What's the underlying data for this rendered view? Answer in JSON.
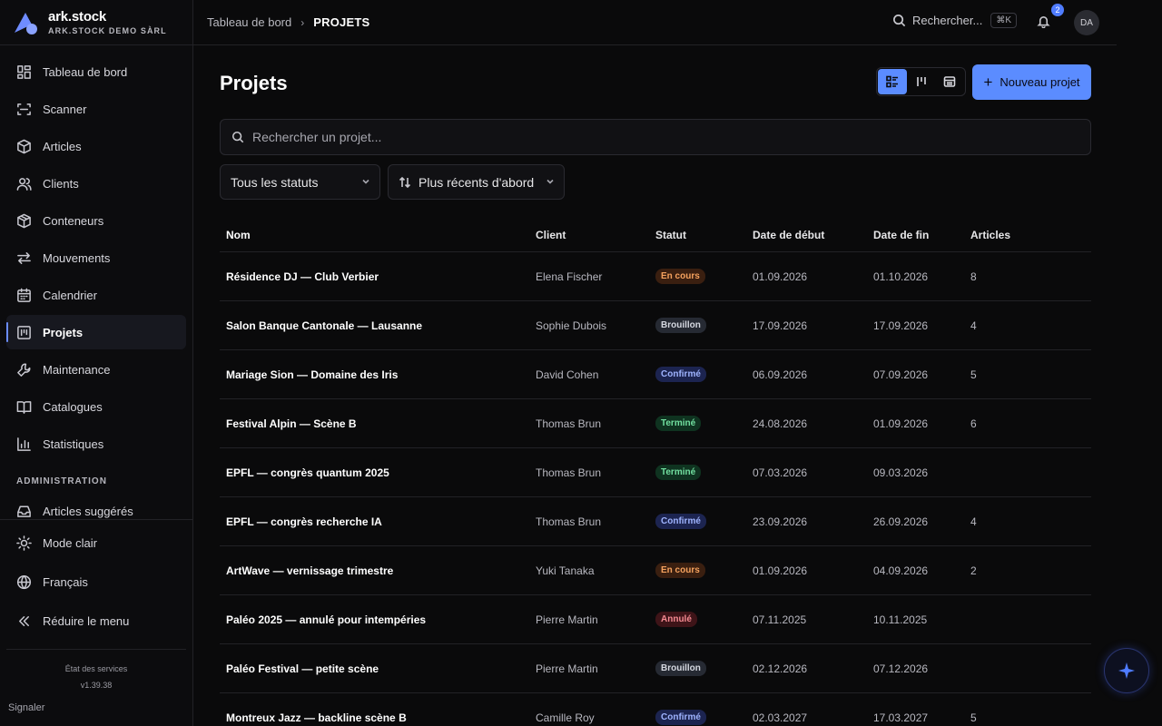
{
  "brand": {
    "name": "ark.stock",
    "org": "ARK.STOCK DEMO SÀRL"
  },
  "sidebar": {
    "items": [
      {
        "label": "Tableau de bord",
        "icon": "dashboard-icon"
      },
      {
        "label": "Scanner",
        "icon": "scan-icon"
      },
      {
        "label": "Articles",
        "icon": "box-icon"
      },
      {
        "label": "Clients",
        "icon": "users-icon"
      },
      {
        "label": "Conteneurs",
        "icon": "container-icon"
      },
      {
        "label": "Mouvements",
        "icon": "arrows-icon"
      },
      {
        "label": "Calendrier",
        "icon": "calendar-icon"
      },
      {
        "label": "Projets",
        "icon": "projects-icon",
        "active": true
      },
      {
        "label": "Maintenance",
        "icon": "wrench-icon"
      },
      {
        "label": "Catalogues",
        "icon": "book-icon"
      },
      {
        "label": "Statistiques",
        "icon": "chart-icon"
      }
    ],
    "admin_section": "ADMINISTRATION",
    "admin_items": [
      {
        "label": "Articles suggérés",
        "icon": "inbox-icon"
      }
    ],
    "bottom_items": [
      {
        "label": "Mode clair",
        "icon": "sun-icon"
      },
      {
        "label": "Français",
        "icon": "globe-icon"
      },
      {
        "label": "Réduire le menu",
        "icon": "chevrons-left-icon"
      }
    ],
    "status_link": "État des services",
    "version": "v1.39.38",
    "report": "Signaler"
  },
  "topbar": {
    "breadcrumb_home": "Tableau de bord",
    "breadcrumb_current": "PROJETS",
    "search_label": "Rechercher...",
    "search_shortcut": "⌘K",
    "notifications_count": "2",
    "avatar_initials": "DA"
  },
  "main": {
    "title": "Projets",
    "new_button": "Nouveau projet",
    "search_placeholder": "Rechercher un projet...",
    "status_filter": "Tous les statuts",
    "sort_filter": "Plus récents d'abord",
    "columns": {
      "nom": "Nom",
      "client": "Client",
      "statut": "Statut",
      "debut": "Date de début",
      "fin": "Date de fin",
      "articles": "Articles"
    },
    "rows": [
      {
        "nom": "Résidence DJ — Club Verbier",
        "client": "Elena Fischer",
        "statut": "En cours",
        "statut_kind": "encours",
        "debut": "01.09.2026",
        "fin": "01.10.2026",
        "articles": "8"
      },
      {
        "nom": "Salon Banque Cantonale — Lausanne",
        "client": "Sophie Dubois",
        "statut": "Brouillon",
        "statut_kind": "brouillon",
        "debut": "17.09.2026",
        "fin": "17.09.2026",
        "articles": "4"
      },
      {
        "nom": "Mariage Sion — Domaine des Iris",
        "client": "David Cohen",
        "statut": "Confirmé",
        "statut_kind": "confirme",
        "debut": "06.09.2026",
        "fin": "07.09.2026",
        "articles": "5"
      },
      {
        "nom": "Festival Alpin — Scène B",
        "client": "Thomas Brun",
        "statut": "Terminé",
        "statut_kind": "termine",
        "debut": "24.08.2026",
        "fin": "01.09.2026",
        "articles": "6"
      },
      {
        "nom": "EPFL — congrès quantum 2025",
        "client": "Thomas Brun",
        "statut": "Terminé",
        "statut_kind": "termine",
        "debut": "07.03.2026",
        "fin": "09.03.2026",
        "articles": ""
      },
      {
        "nom": "EPFL — congrès recherche IA",
        "client": "Thomas Brun",
        "statut": "Confirmé",
        "statut_kind": "confirme",
        "debut": "23.09.2026",
        "fin": "26.09.2026",
        "articles": "4"
      },
      {
        "nom": "ArtWave — vernissage trimestre",
        "client": "Yuki Tanaka",
        "statut": "En cours",
        "statut_kind": "encours",
        "debut": "01.09.2026",
        "fin": "04.09.2026",
        "articles": "2"
      },
      {
        "nom": "Paléo 2025 — annulé pour intempéries",
        "client": "Pierre Martin",
        "statut": "Annulé",
        "statut_kind": "annule",
        "debut": "07.11.2025",
        "fin": "10.11.2025",
        "articles": ""
      },
      {
        "nom": "Paléo Festival — petite scène",
        "client": "Pierre Martin",
        "statut": "Brouillon",
        "statut_kind": "brouillon",
        "debut": "02.12.2026",
        "fin": "07.12.2026",
        "articles": ""
      },
      {
        "nom": "Montreux Jazz — backline scène B",
        "client": "Camille Roy",
        "statut": "Confirmé",
        "statut_kind": "confirme",
        "debut": "02.03.2027",
        "fin": "17.03.2027",
        "articles": "5"
      }
    ]
  },
  "colors": {
    "accent": "#5b8cff",
    "background": "#0a0a0b",
    "sidebar": "#0c0c0e"
  }
}
